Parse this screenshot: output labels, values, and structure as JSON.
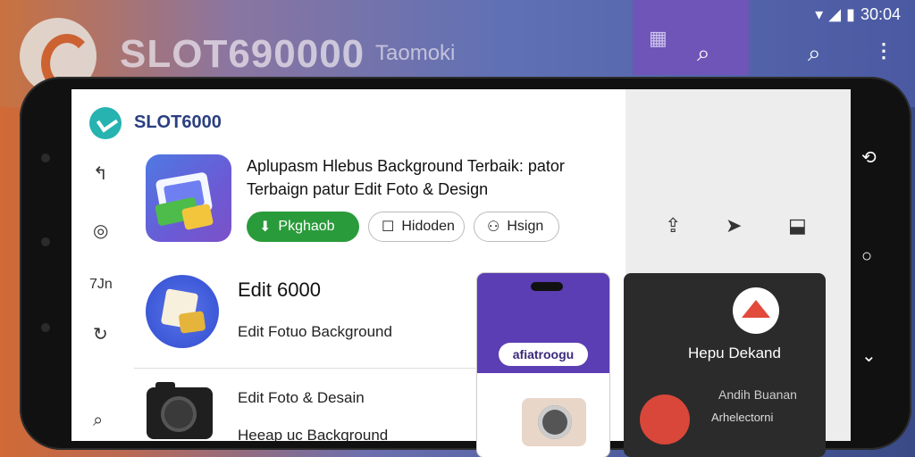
{
  "background": {
    "brand": "SLOT690000",
    "sub": "Taomoki"
  },
  "statusbar": {
    "time": "30:04",
    "signal_icon": "signal-icon",
    "battery_icon": "battery-icon"
  },
  "app": {
    "title": "SLOT6000"
  },
  "sidebar": {
    "items": [
      {
        "icon": "back-icon",
        "glyph": "⟲"
      },
      {
        "icon": "camera-icon",
        "glyph": "◎"
      },
      {
        "label": "7Jn"
      },
      {
        "icon": "refresh-icon",
        "glyph": "↻"
      },
      {
        "icon": "search-icon",
        "glyph": "⌕"
      }
    ]
  },
  "main": {
    "app_card": {
      "title_line1": "Aplupasm Hlebus Background Terbaik: pator",
      "title_line2": "Terbaign patur Edit Foto & Design",
      "download_label": "Pkghaob",
      "hidden_label": "Hidoden",
      "design_label": "Hsign"
    },
    "item1": {
      "title": "Edit 6000",
      "subtitle": "Edit Fotuo Background"
    },
    "item2": {
      "title": "Edit Foto & Desain",
      "subtitle": "Heeap uc Background"
    }
  },
  "mock1": {
    "pill": "afiatroogu"
  },
  "mock2": {
    "title": "Hepu Dekand",
    "sub1": "Andih Buanan",
    "sub2": "Arhelectorni"
  },
  "colors": {
    "accent": "#2a9b3a",
    "brand": "#2b3f80",
    "purple": "#5b3db4"
  }
}
